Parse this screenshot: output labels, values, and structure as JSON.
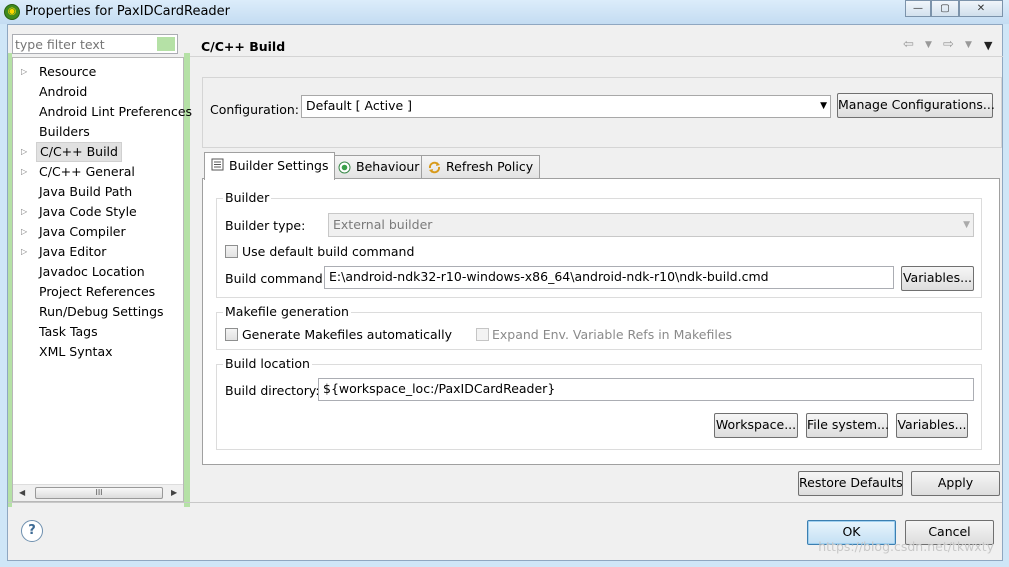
{
  "window": {
    "title": "Properties for PaxIDCardReader",
    "minimize_glyph": "—",
    "maximize_glyph": "▢",
    "close_glyph": "✕"
  },
  "filter": {
    "placeholder": "type filter text"
  },
  "tree": {
    "items": [
      {
        "label": "Resource",
        "expandable": true
      },
      {
        "label": "Android",
        "expandable": false
      },
      {
        "label": "Android Lint Preferences",
        "expandable": false
      },
      {
        "label": "Builders",
        "expandable": false
      },
      {
        "label": "C/C++ Build",
        "expandable": true,
        "selected": true
      },
      {
        "label": "C/C++ General",
        "expandable": true
      },
      {
        "label": "Java Build Path",
        "expandable": false
      },
      {
        "label": "Java Code Style",
        "expandable": true
      },
      {
        "label": "Java Compiler",
        "expandable": true
      },
      {
        "label": "Java Editor",
        "expandable": true
      },
      {
        "label": "Javadoc Location",
        "expandable": false
      },
      {
        "label": "Project References",
        "expandable": false
      },
      {
        "label": "Run/Debug Settings",
        "expandable": false
      },
      {
        "label": "Task Tags",
        "expandable": false
      },
      {
        "label": "XML Syntax",
        "expandable": false
      }
    ],
    "scroll_thumb": "III"
  },
  "page": {
    "title": "C/C++ Build",
    "configuration_label": "Configuration:",
    "configuration_value": "Default  [ Active ]",
    "manage_button": "Manage Configurations...",
    "tabs": [
      {
        "label": "Builder Settings",
        "icon": "list-icon"
      },
      {
        "label": "Behaviour",
        "icon": "radio-icon"
      },
      {
        "label": "Refresh Policy",
        "icon": "refresh-icon"
      }
    ],
    "builder": {
      "group_title": "Builder",
      "type_label": "Builder type:",
      "type_value": "External builder",
      "use_default_label": "Use default build command",
      "command_label": "Build command:",
      "command_value": "E:\\android-ndk32-r10-windows-x86_64\\android-ndk-r10\\ndk-build.cmd",
      "variables_button": "Variables..."
    },
    "makefile": {
      "group_title": "Makefile generation",
      "generate_label": "Generate Makefiles automatically",
      "expand_label": "Expand Env. Variable Refs in Makefiles"
    },
    "location": {
      "group_title": "Build location",
      "directory_label": "Build directory:",
      "directory_value": "${workspace_loc:/PaxIDCardReader}",
      "workspace_button": "Workspace...",
      "filesystem_button": "File system...",
      "variables_button": "Variables..."
    },
    "restore_button": "Restore Defaults",
    "apply_button": "Apply"
  },
  "footer": {
    "help_glyph": "?",
    "ok_button": "OK",
    "cancel_button": "Cancel",
    "watermark": "https://blog.csdn.net/tkwxty"
  }
}
